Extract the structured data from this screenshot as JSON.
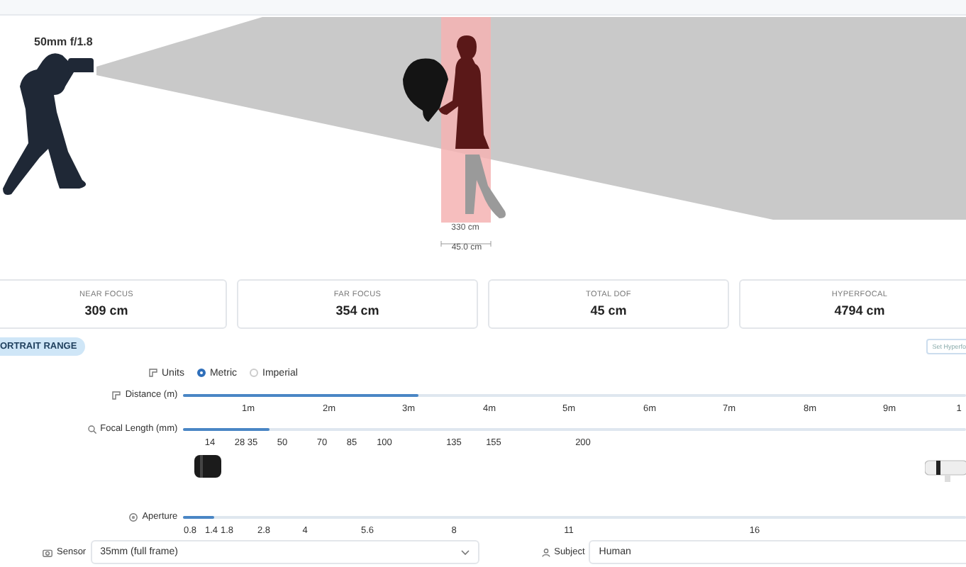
{
  "scene": {
    "lens_label": "50mm f/1.8",
    "focus_distance": "330 cm",
    "dof_width": "45.0 cm"
  },
  "stats": [
    {
      "label": "NEAR FOCUS",
      "value": "309 cm"
    },
    {
      "label": "FAR FOCUS",
      "value": "354 cm"
    },
    {
      "label": "TOTAL DOF",
      "value": "45 cm"
    },
    {
      "label": "HYPERFOCAL",
      "value": "4794 cm"
    }
  ],
  "mode_badge": "ORTRAIT RANGE",
  "hyperfocal_button": "Set Hyperfo",
  "units": {
    "label": "Units",
    "options": [
      {
        "label": "Metric",
        "selected": true
      },
      {
        "label": "Imperial",
        "selected": false
      }
    ]
  },
  "sliders": [
    {
      "kind": "distance",
      "label": "Distance (m)",
      "level": 0.3,
      "ticks": [
        "1m",
        "2m",
        "3m",
        "4m",
        "5m",
        "6m",
        "7m",
        "8m",
        "9m",
        "1"
      ]
    },
    {
      "kind": "focal",
      "label": "Focal Length (mm)",
      "level": 0.11,
      "ticks": [
        "14",
        "28",
        "35",
        "50",
        "70",
        "85",
        "100",
        "135",
        "155",
        "200"
      ]
    },
    {
      "kind": "aperture",
      "label": "Aperture",
      "level": 0.04,
      "ticks": [
        "0.8",
        "1.4",
        "1.8",
        "2.8",
        "4",
        "5.6",
        "8",
        "11",
        "16"
      ]
    }
  ],
  "selects": [
    {
      "kind": "sensor",
      "label": "Sensor",
      "value": "35mm (full frame)"
    },
    {
      "kind": "subject",
      "label": "Subject",
      "value": "Human"
    }
  ]
}
